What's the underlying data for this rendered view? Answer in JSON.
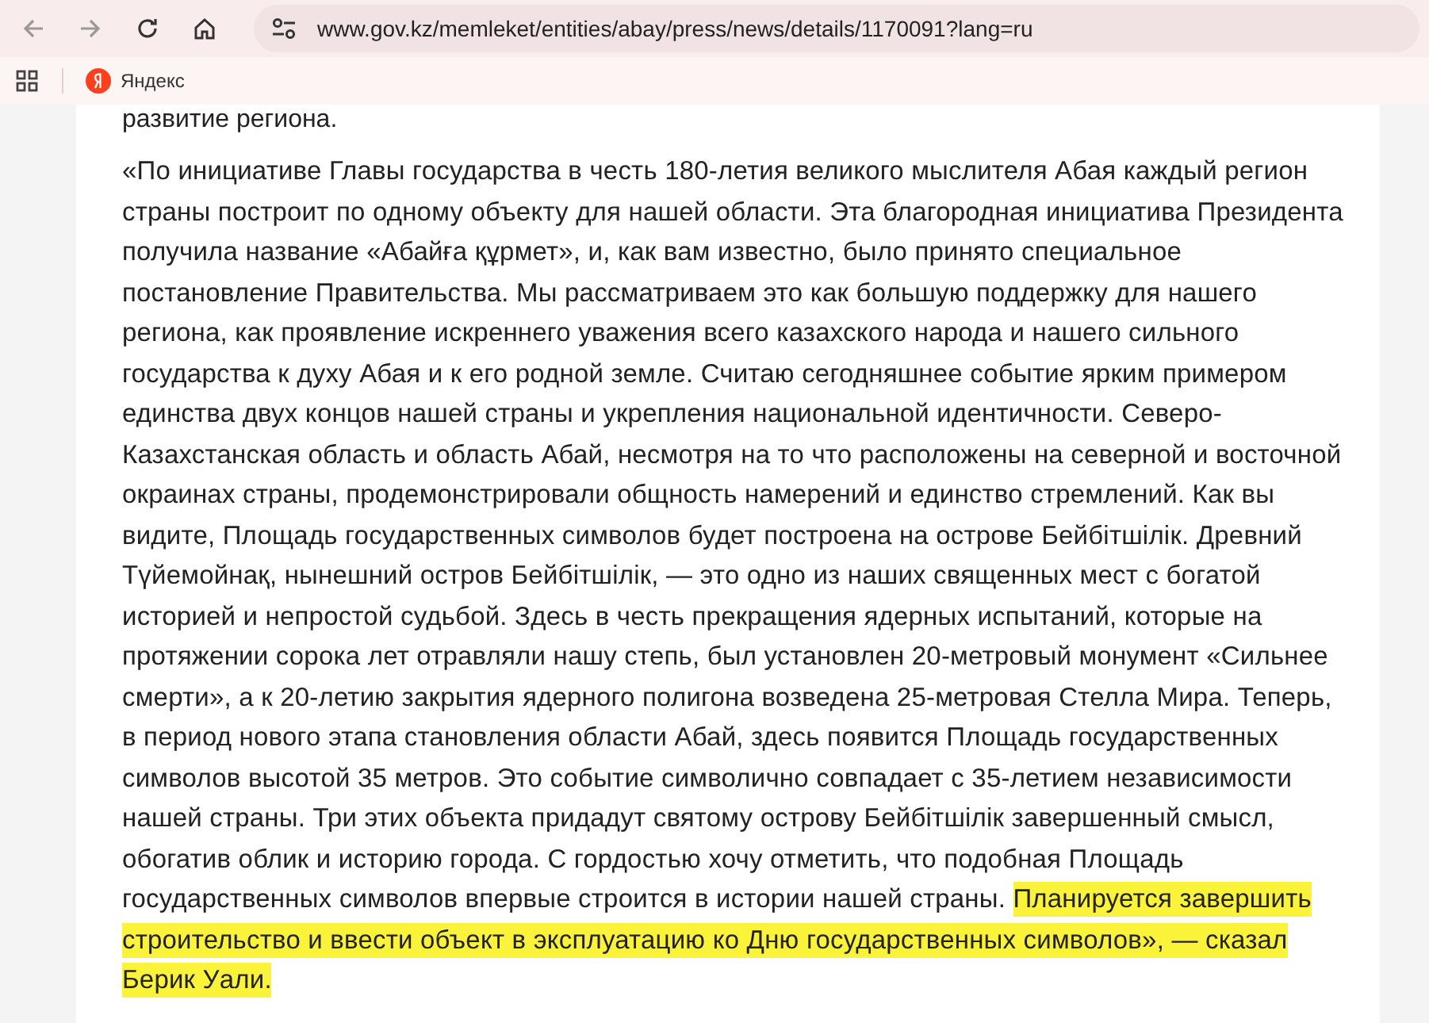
{
  "browser": {
    "url": "www.gov.kz/memleket/entities/abay/press/news/details/1170091?lang=ru",
    "bookmarks": [
      {
        "label": "Яндекс"
      }
    ]
  },
  "article": {
    "cut_line": "развитие региона.",
    "paragraph": [
      {
        "text": "«По инициативе Главы государства в честь 180-летия великого мыслителя Абая каждый регион страны построит по одному объекту для нашей области. Эта благородная инициатива Президента получила название «Абайға құрмет», и, как вам известно, было принято специальное постановление Правительства. Мы рассматриваем это как большую поддержку для нашего региона, как проявление искреннего уважения всего казахского народа и нашего сильного государства к духу Абая и к его родной земле. Считаю сегодняшнее событие ярким примером единства двух концов нашей страны и укрепления национальной идентичности. Северо-Казахстанская область и область Абай, несмотря на то что расположены на северной и восточной окраинах страны, продемонстрировали общность намерений и единство стремлений. Как вы видите, Площадь государственных символов будет построена на острове Бейбітшілік. Древний Түйемойнақ, нынешний остров Бейбітшілік, — это одно из наших священных мест с богатой историей и непростой судьбой. Здесь в честь прекращения ядерных испытаний, которые на протяжении сорока лет отравляли нашу степь, был установлен 20-метровый монумент «Сильнее смерти», а к 20-летию закрытия ядерного полигона возведена 25-метровая Стелла Мира. Теперь, в период нового этапа становления области Абай, здесь появится Площадь государственных символов высотой 35 метров. Это событие символично совпадает с 35-летием независимости нашей страны. Три этих объекта придадут святому острову Бейбітшілік завершенный смысл, обогатив облик и историю города. С гордостью хочу отметить, что подобная Площадь государственных символов впервые строится в истории нашей страны. ",
        "highlighted": false
      },
      {
        "text": "Планируется завершить строительство и ввести объект в эксплуатацию ко Дню государственных символов», — сказал Берик Уали.",
        "highlighted": true
      }
    ]
  }
}
